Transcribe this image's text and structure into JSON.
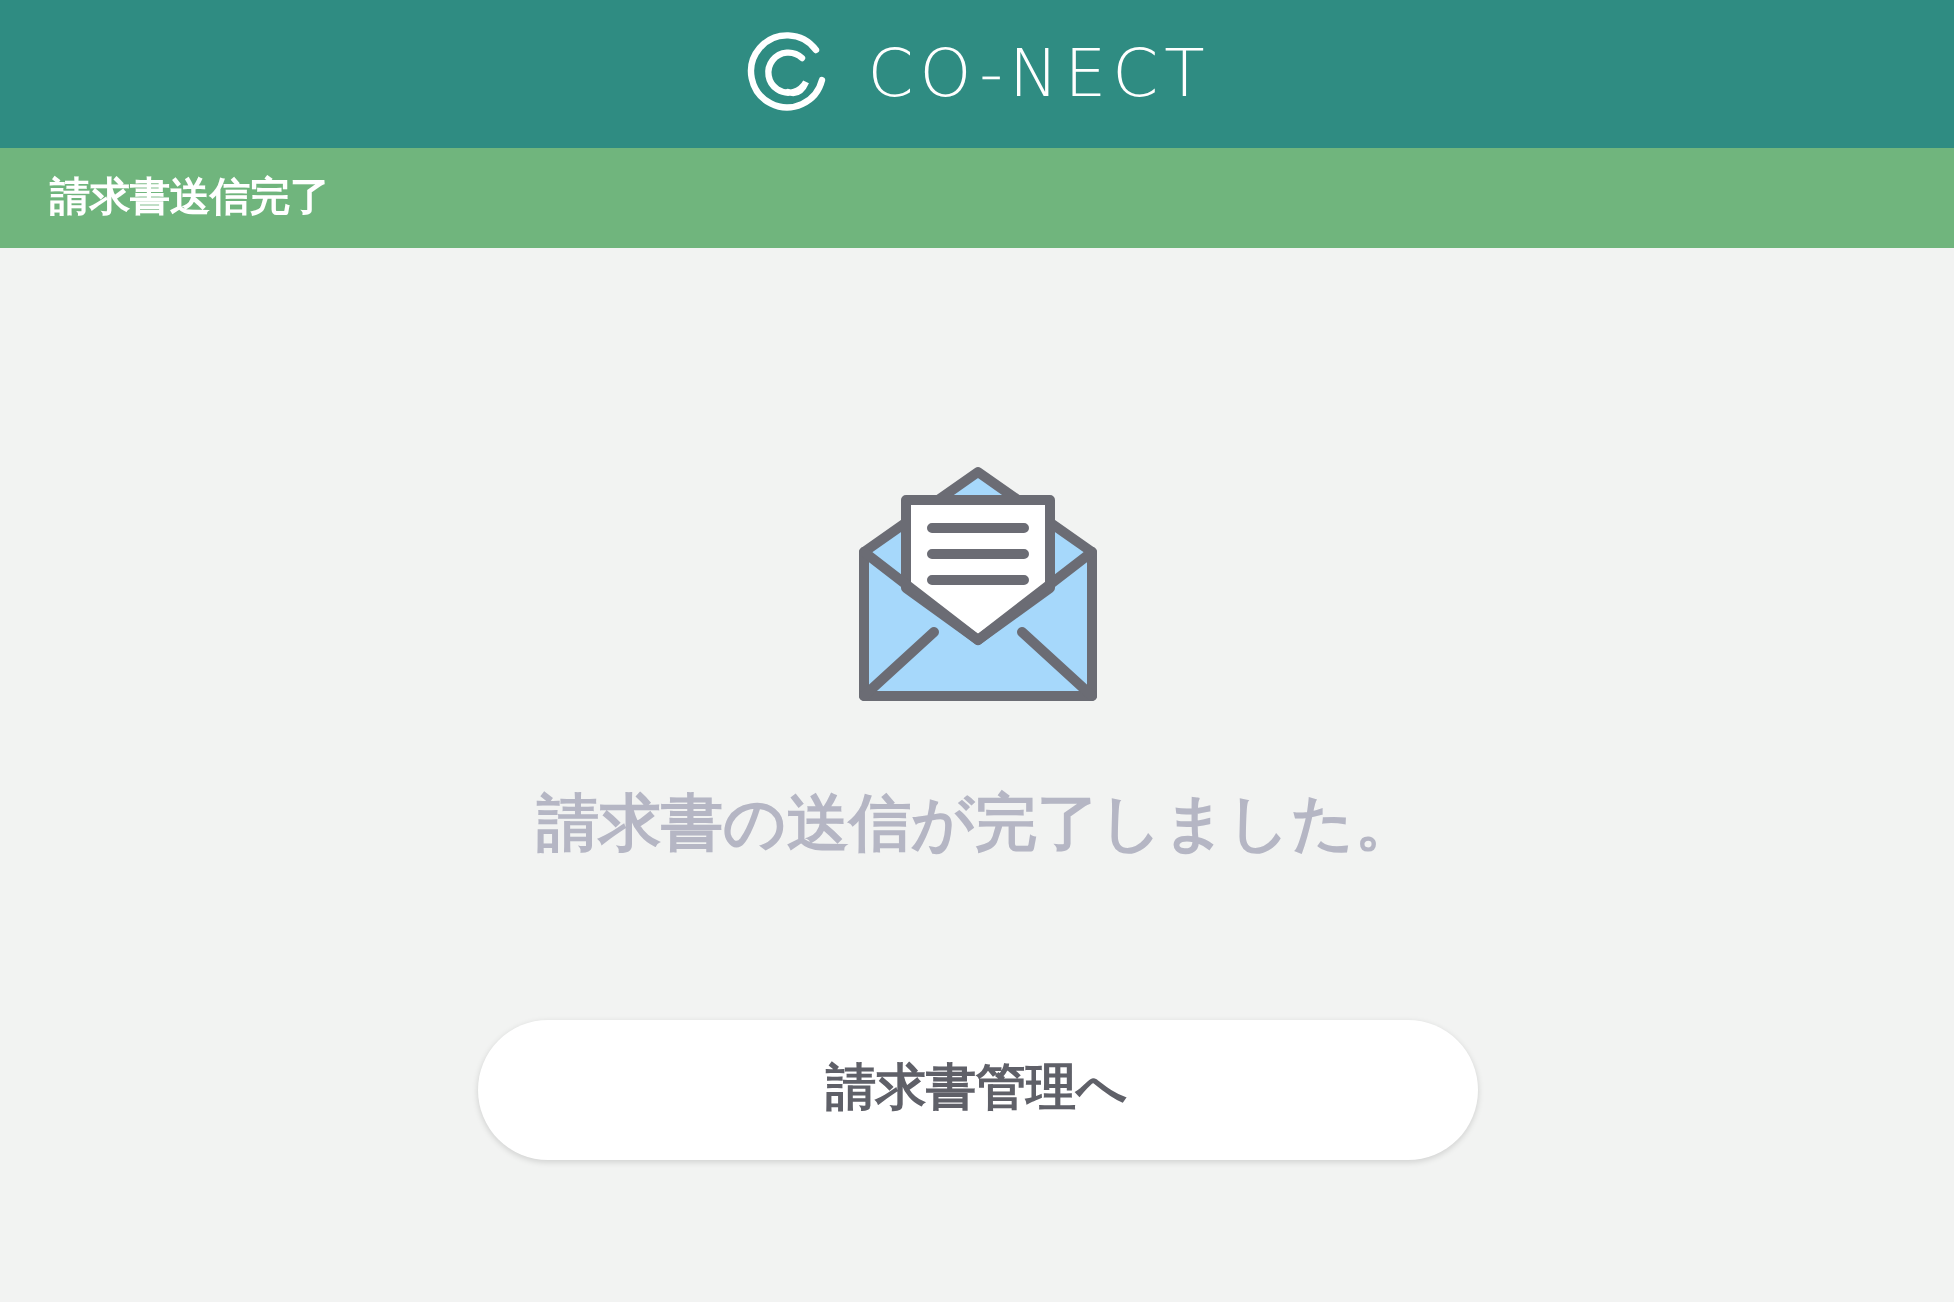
{
  "header": {
    "logo_text": "CO-NECT"
  },
  "title_bar": {
    "title": "請求書送信完了"
  },
  "message": "請求書の送信が完了しました。",
  "button": {
    "label": "請求書管理へ"
  }
}
